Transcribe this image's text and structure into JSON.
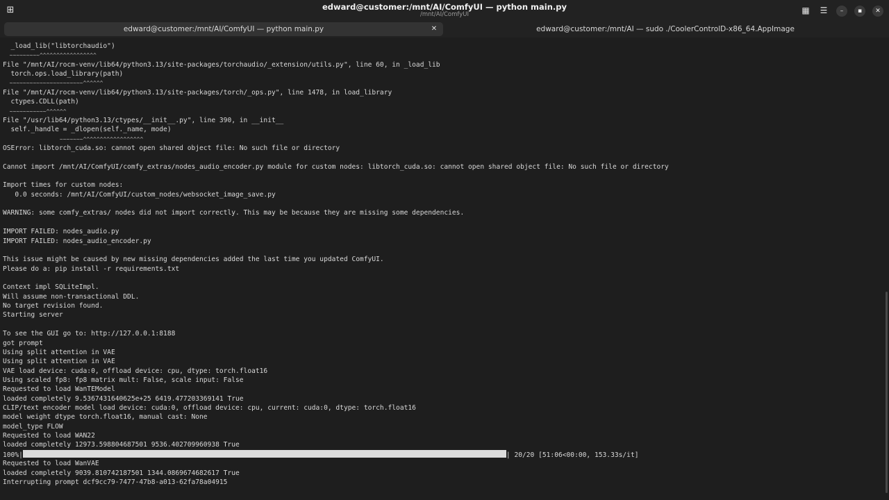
{
  "window": {
    "title": "edward@customer:/mnt/AI/ComfyUI — python main.py",
    "subtitle": "/mnt/AI/ComfyUI"
  },
  "tabs": [
    {
      "label": "edward@customer:/mnt/AI/ComfyUI — python main.py"
    },
    {
      "label": "edward@customer:/mnt/AI — sudo ./CoolerControlD-x86_64.AppImage"
    }
  ],
  "icons": {
    "new_tab": "plus-square-icon",
    "grid": "grid-icon",
    "menu": "hamburger-icon",
    "minimize": "minimize-icon",
    "maximize": "maximize-icon",
    "close": "close-icon",
    "tab_close": "close-icon"
  },
  "terminal": {
    "lines": [
      "  _load_lib(\"libtorchaudio\")",
      "  ~~~~~~~~~^^^^^^^^^^^^^^^^^",
      "File \"/mnt/AI/rocm-venv/lib64/python3.13/site-packages/torchaudio/_extension/utils.py\", line 60, in _load_lib",
      "  torch.ops.load_library(path)",
      "  ~~~~~~~~~~~~~~~~~~~~~~^^^^^^",
      "File \"/mnt/AI/rocm-venv/lib64/python3.13/site-packages/torch/_ops.py\", line 1478, in load_library",
      "  ctypes.CDLL(path)",
      "  ~~~~~~~~~~~^^^^^^",
      "File \"/usr/lib64/python3.13/ctypes/__init__.py\", line 390, in __init__",
      "  self._handle = _dlopen(self._name, mode)",
      "                 ~~~~~~~^^^^^^^^^^^^^^^^^^",
      "OSError: libtorch_cuda.so: cannot open shared object file: No such file or directory",
      "",
      "Cannot import /mnt/AI/ComfyUI/comfy_extras/nodes_audio_encoder.py module for custom nodes: libtorch_cuda.so: cannot open shared object file: No such file or directory",
      "",
      "Import times for custom nodes:",
      "   0.0 seconds: /mnt/AI/ComfyUI/custom_nodes/websocket_image_save.py",
      "",
      "WARNING: some comfy_extras/ nodes did not import correctly. This may be because they are missing some dependencies.",
      "",
      "IMPORT FAILED: nodes_audio.py",
      "IMPORT FAILED: nodes_audio_encoder.py",
      "",
      "This issue might be caused by new missing dependencies added the last time you updated ComfyUI.",
      "Please do a: pip install -r requirements.txt",
      "",
      "Context impl SQLiteImpl.",
      "Will assume non-transactional DDL.",
      "No target revision found.",
      "Starting server",
      "",
      "To see the GUI go to: http://127.0.0.1:8188",
      "got prompt",
      "Using split attention in VAE",
      "Using split attention in VAE",
      "VAE load device: cuda:0, offload device: cpu, dtype: torch.float16",
      "Using scaled fp8: fp8 matrix mult: False, scale input: False",
      "Requested to load WanTEModel",
      "loaded completely 9.5367431640625e+25 6419.477203369141 True",
      "CLIP/text encoder model load device: cuda:0, offload device: cpu, current: cuda:0, dtype: torch.float16",
      "model weight dtype torch.float16, manual cast: None",
      "model_type FLOW",
      "Requested to load WAN22",
      "loaded completely 12973.598804687501 9536.402709960938 True"
    ],
    "progress": {
      "percent_label": "100%|",
      "fraction": 1.0,
      "suffix": "| 20/20 [51:06<00:00, 153.33s/it]"
    },
    "after_lines": [
      "Requested to load WanVAE",
      "loaded completely 9039.810742187501 1344.0869674682617 True",
      "Interrupting prompt dcf9cc79-7477-47b8-a013-62fa78a04915"
    ]
  }
}
